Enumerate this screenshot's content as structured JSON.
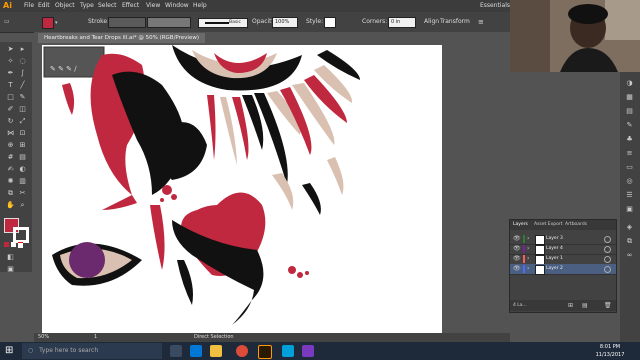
{
  "app": {
    "logo": "Ai",
    "workspace": "Essentials"
  },
  "menu": [
    "File",
    "Edit",
    "Object",
    "Type",
    "Select",
    "Effect",
    "View",
    "Window",
    "Help"
  ],
  "window_controls": {
    "min": "–",
    "max": "□",
    "close": "✕"
  },
  "control_bar": {
    "stroke_label": "Stroke:",
    "stroke_style": "Basic",
    "opacity_label": "Opacity:",
    "opacity_value": "100%",
    "style_label": "Style:",
    "corners_label": "Corners:",
    "corners_value": "0 in",
    "align_label": "Align",
    "transform_label": "Transform",
    "fill_color": "#c0283f"
  },
  "document_tab": "Heartbreaks and Tear Drops ill.ai* @ 50% (RGB/Preview)",
  "status": {
    "zoom": "50%",
    "page": "1",
    "tool": "Direct Selection"
  },
  "layers_panel": {
    "tabs": [
      "Layers",
      "Asset Export",
      "Artboards"
    ],
    "layers": [
      {
        "name": "Layer 3",
        "color": "#2e7d32"
      },
      {
        "name": "Layer 4",
        "color": "#7b1fa2"
      },
      {
        "name": "Layer 1",
        "color": "#ff5a5a"
      },
      {
        "name": "Layer 2",
        "color": "#4a6cff"
      }
    ],
    "footer": "4 La..."
  },
  "taskbar": {
    "search_placeholder": "Type here to search",
    "time": "8:01 PM",
    "date": "11/13/2017"
  },
  "colors": {
    "heart_red": "#c0283f",
    "black": "#111111",
    "tan": "#d9c0b0",
    "purple": "#6b2a6e"
  }
}
